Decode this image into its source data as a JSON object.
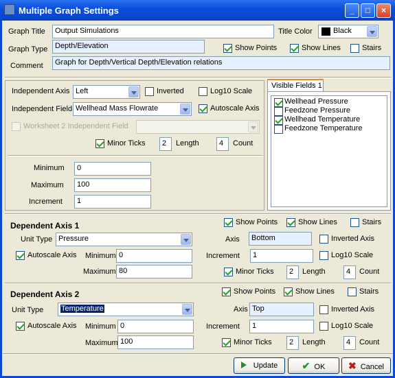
{
  "window": {
    "title": "Multiple Graph Settings",
    "btn_min": "_",
    "btn_max": "□",
    "btn_close": "×"
  },
  "general": {
    "graph_title_label": "Graph Title",
    "graph_title": "Output Simulations",
    "title_color_label": "Title Color",
    "title_color": "Black",
    "graph_type_label": "Graph Type",
    "graph_type": "Depth/Elevation",
    "show_points": "Show Points",
    "show_lines": "Show Lines",
    "stairs": "Stairs",
    "comment_label": "Comment",
    "comment": "Graph for Depth/Vertical Depth/Elevation relations"
  },
  "independent": {
    "axis_label": "Independent Axis",
    "axis": "Left",
    "inverted": "Inverted",
    "log10": "Log10 Scale",
    "field_label": "Independent Field",
    "field": "Wellhead Mass Flowrate",
    "autoscale": "Autoscale Axis",
    "worksheet2": "Worksheet 2 Independent Field",
    "minor_ticks": "Minor Ticks",
    "length_label": "Length",
    "length": "2",
    "count_label": "Count",
    "count": "4",
    "minimum_label": "Minimum",
    "minimum": "0",
    "maximum_label": "Maximum",
    "maximum": "100",
    "increment_label": "Increment",
    "increment": "1"
  },
  "visible": {
    "tab": "Visible Fields 1",
    "fields": [
      {
        "label": "Wellhead Pressure",
        "checked": true
      },
      {
        "label": "Feedzone Pressure",
        "checked": false
      },
      {
        "label": "Wellhead Temperature",
        "checked": true
      },
      {
        "label": "Feedzone Temperature",
        "checked": false
      }
    ]
  },
  "dep1": {
    "title": "Dependent Axis 1",
    "show_points": "Show Points",
    "show_lines": "Show Lines",
    "stairs": "Stairs",
    "unit_type_label": "Unit Type",
    "unit_type": "Pressure",
    "axis_label": "Axis",
    "axis": "Bottom",
    "inverted": "Inverted Axis",
    "autoscale": "Autoscale Axis",
    "minimum_label": "Minimum",
    "minimum": "0",
    "increment_label": "Increment",
    "increment": "1",
    "log10": "Log10 Scale",
    "maximum_label": "Maximum",
    "maximum": "80",
    "minor_ticks": "Minor Ticks",
    "length_label": "Length",
    "length": "2",
    "count_label": "Count",
    "count": "4"
  },
  "dep2": {
    "title": "Dependent Axis 2",
    "show_points": "Show Points",
    "show_lines": "Show Lines",
    "stairs": "Stairs",
    "unit_type_label": "Unit Type",
    "unit_type": "Temperature",
    "axis_label": "Axis",
    "axis": "Top",
    "inverted": "Inverted Axis",
    "autoscale": "Autoscale Axis",
    "minimum_label": "Minimum",
    "minimum": "0",
    "increment_label": "Increment",
    "increment": "1",
    "log10": "Log10 Scale",
    "maximum_label": "Maximum",
    "maximum": "100",
    "minor_ticks": "Minor Ticks",
    "length_label": "Length",
    "length": "2",
    "count_label": "Count",
    "count": "4"
  },
  "buttons": {
    "update": "Update",
    "ok": "OK",
    "cancel": "Cancel"
  },
  "colors": {
    "title_color_swatch": "#000000",
    "accent": "#0a48d8"
  }
}
